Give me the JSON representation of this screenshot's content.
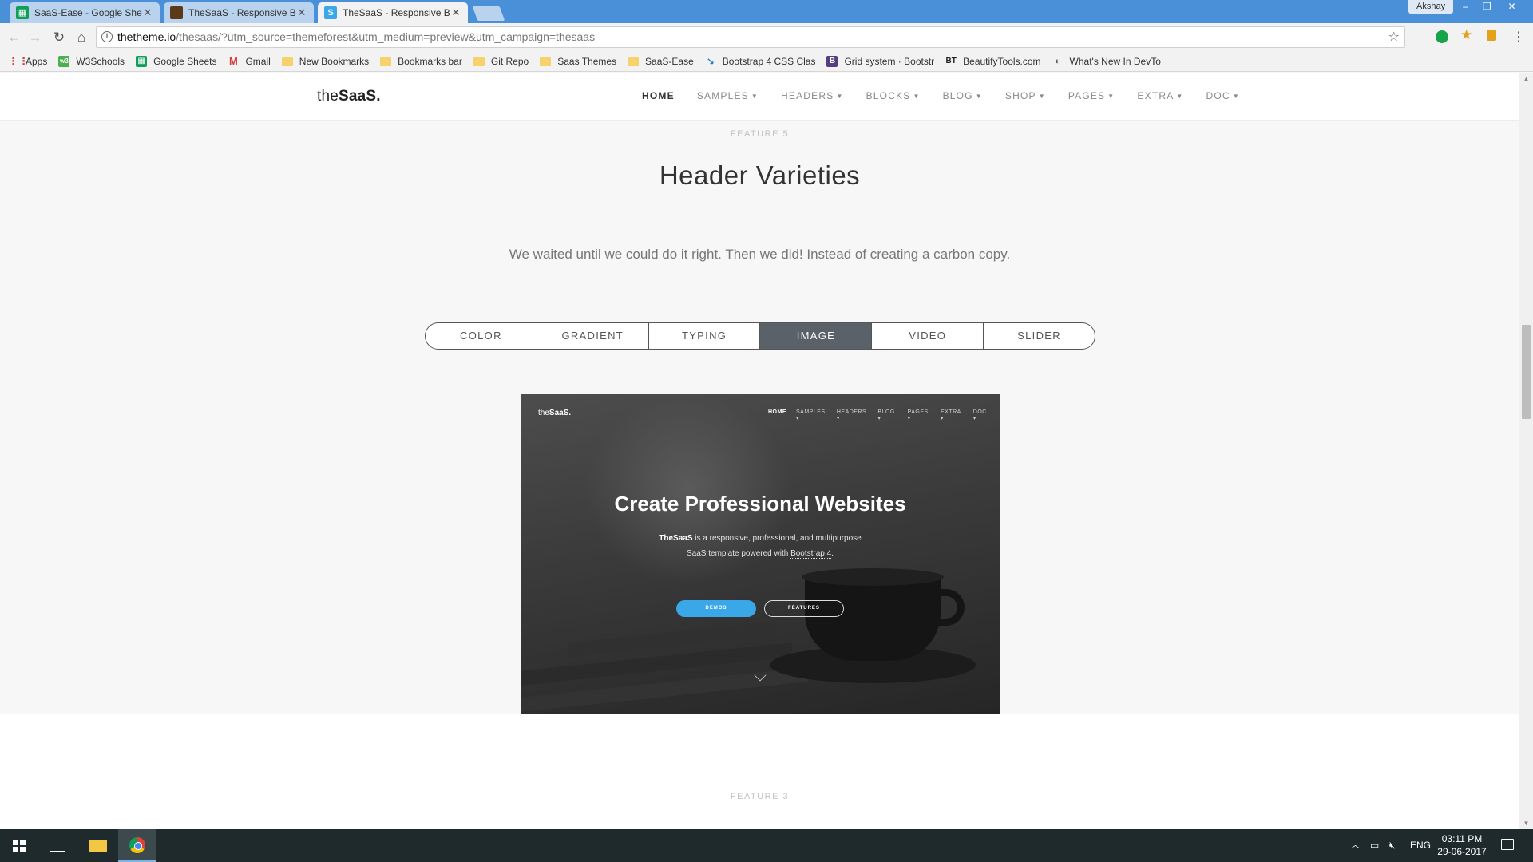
{
  "browser": {
    "tabs": [
      {
        "label": "SaaS-Ease - Google Shee",
        "favicon": "sheets-icon",
        "color": "#0f9d58"
      },
      {
        "label": "TheSaaS - Responsive Bo",
        "favicon": "theme-icon",
        "color": "#5b3a1a"
      },
      {
        "label": "TheSaaS - Responsive Bo",
        "favicon": "s-icon",
        "color": "#3aa7e8"
      }
    ],
    "profile_name": "Akshay",
    "url_host": "thetheme.io",
    "url_path": "/thesaas/?utm_source=themeforest&utm_medium=preview&utm_campaign=thesaas",
    "bookmarks": [
      {
        "label": "Apps",
        "icon": "apps-grid-icon"
      },
      {
        "label": "W3Schools",
        "icon": "w3schools-icon"
      },
      {
        "label": "Google Sheets",
        "icon": "sheets-icon"
      },
      {
        "label": "Gmail",
        "icon": "gmail-icon"
      },
      {
        "label": "New Bookmarks",
        "icon": "folder-icon"
      },
      {
        "label": "Bookmarks bar",
        "icon": "folder-icon"
      },
      {
        "label": "Git Repo",
        "icon": "folder-icon"
      },
      {
        "label": "Saas Themes",
        "icon": "folder-icon"
      },
      {
        "label": "SaaS-Ease",
        "icon": "folder-icon"
      },
      {
        "label": "Bootstrap 4 CSS Clas",
        "icon": "bootstrap-icon"
      },
      {
        "label": "Grid system · Bootstr",
        "icon": "bootstrap-b-icon"
      },
      {
        "label": "BeautifyTools.com",
        "icon": "beautify-icon"
      },
      {
        "label": "What's New In DevTo",
        "icon": "devtools-icon"
      }
    ]
  },
  "site": {
    "logo_light": "the",
    "logo_bold": "SaaS.",
    "menu": [
      {
        "label": "HOME",
        "active": true,
        "has_caret": false
      },
      {
        "label": "SAMPLES",
        "active": false,
        "has_caret": true
      },
      {
        "label": "HEADERS",
        "active": false,
        "has_caret": true
      },
      {
        "label": "BLOCKS",
        "active": false,
        "has_caret": true
      },
      {
        "label": "BLOG",
        "active": false,
        "has_caret": true
      },
      {
        "label": "SHOP",
        "active": false,
        "has_caret": true
      },
      {
        "label": "PAGES",
        "active": false,
        "has_caret": true
      },
      {
        "label": "EXTRA",
        "active": false,
        "has_caret": true
      },
      {
        "label": "DOC",
        "active": false,
        "has_caret": true
      }
    ]
  },
  "section": {
    "eyebrow": "FEATURE 5",
    "title": "Header Varieties",
    "lead": "We waited until we could do it right. Then we did! Instead of creating a carbon copy.",
    "tabs": [
      "COLOR",
      "GRADIENT",
      "TYPING",
      "IMAGE",
      "VIDEO",
      "SLIDER"
    ],
    "active_tab": "IMAGE"
  },
  "preview": {
    "logo_light": "the",
    "logo_bold": "SaaS.",
    "menu": [
      "HOME",
      "SAMPLES ▾",
      "HEADERS ▾",
      "BLOG ▾",
      "PAGES ▾",
      "EXTRA ▾",
      "DOC ▾"
    ],
    "title": "Create Professional Websites",
    "sub_brand": "TheSaaS",
    "sub_line1": " is a responsive, professional, and multipurpose",
    "sub_line2_a": "SaaS template powered with ",
    "sub_link": "Bootstrap 4",
    "sub_line2_b": ".",
    "btn_demos": "DEMOS",
    "btn_features": "FEATURES"
  },
  "next_section": {
    "eyebrow": "FEATURE 3"
  },
  "taskbar": {
    "language": "ENG",
    "time": "03:11 PM",
    "date": "29-06-2017"
  },
  "colors": {
    "tab_strip": "#4a90d9",
    "active_tab_bg": "#5a6169",
    "demos_button": "#3aa7e8",
    "taskbar": "#1f2a2c"
  }
}
